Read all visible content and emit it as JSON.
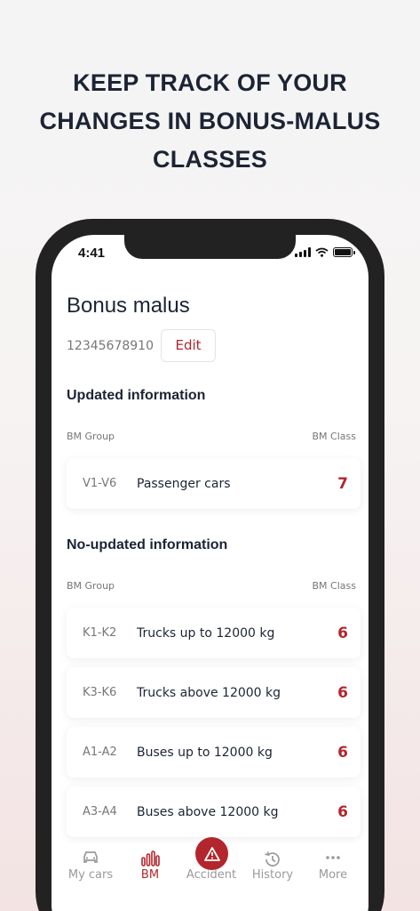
{
  "headline": {
    "line1": "KEEP TRACK OF YOUR",
    "line2": "CHANGES IN BONUS-MALUS",
    "line3": "CLASSES"
  },
  "status": {
    "time": "4:41"
  },
  "page": {
    "title": "Bonus malus",
    "policy_number": "12345678910",
    "edit_label": "Edit"
  },
  "updated": {
    "title": "Updated information",
    "col_group": "BM Group",
    "col_class": "BM Class",
    "rows": [
      {
        "group": "V1-V6",
        "name": "Passenger cars",
        "class": "7"
      }
    ]
  },
  "not_updated": {
    "title": "No-updated information",
    "col_group": "BM Group",
    "col_class": "BM Class",
    "rows": [
      {
        "group": "K1-K2",
        "name": "Trucks up to 12000 kg",
        "class": "6"
      },
      {
        "group": "K3-K6",
        "name": "Trucks above 12000 kg",
        "class": "6"
      },
      {
        "group": "A1-A2",
        "name": "Buses up to 12000 kg",
        "class": "6"
      },
      {
        "group": "A3-A4",
        "name": "Buses above 12000 kg",
        "class": "6"
      }
    ]
  },
  "tabs": {
    "my_cars": "My cars",
    "bm": "BM",
    "accident": "Accident",
    "history": "History",
    "more": "More"
  },
  "colors": {
    "accent": "#b3262d",
    "text_dark": "#1c2434",
    "muted": "#777777"
  },
  "icons": [
    "signal-icon",
    "wifi-icon",
    "battery-icon",
    "car-icon",
    "bar-chart-icon",
    "warning-icon",
    "history-icon",
    "more-dots-icon"
  ]
}
